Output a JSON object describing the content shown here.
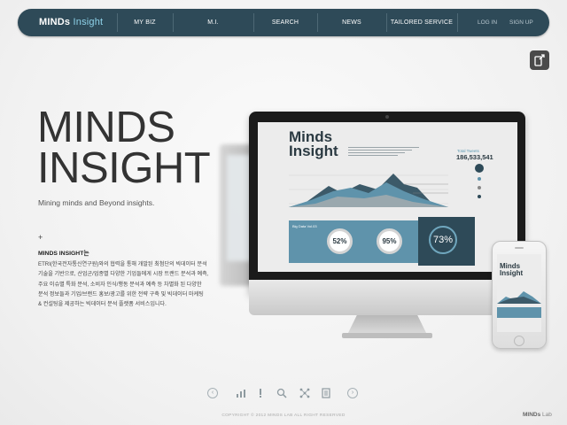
{
  "brand": {
    "name_bold": "MINDs",
    "name_light": " Insight"
  },
  "nav": {
    "items": [
      "MY BIZ",
      "M.I.",
      "SEARCH",
      "NEWS",
      "TAILORED SERVICE"
    ],
    "login": "LOG IN",
    "signup": "SIGN UP"
  },
  "hero": {
    "title_line1": "MINDS",
    "title_line2": "INSIGHT",
    "subtitle": "Mining minds and Beyond insights.",
    "plus": "+",
    "desc_title": "MINDS INSIGHT는",
    "desc_body": "ETRI(한국전자통신연구원)와의 협력을 통해 개발된 최첨단의 빅데이터 분석\n기술을 기반으로, 산업군/업종별 다양한 기업들에게 시장 트랜드 분석과 예측,\n주요 이슈별 특화 분석, 소비자 인식/행동 분석과 예측 등 차별화 된 다양한\n분석 정보들과 기업/브랜드 홍보/광고를 위한 전략 구축 및 빅데이터 마케팅\n& 컨설팅을 제공하는 빅데이터 분석 플랫폼 서비스입니다."
  },
  "device": {
    "screen_title": "Minds Insight",
    "phone_title": "Minds Insight",
    "stat_label": "Total Tweets",
    "stat_value": "186,533,541",
    "ring1": "52%",
    "ring2": "95%",
    "ring3": "73%",
    "panel_label": "Big Data Vol.03"
  },
  "bottom_nav": {
    "prev": "‹",
    "next": "›",
    "icons": [
      "chart-icon",
      "alert-icon",
      "search-icon",
      "network-icon",
      "document-icon"
    ]
  },
  "footer": {
    "copyright": "COPYRIGHT © 2012 MINDS LAB ALL RIGHT RESERVED",
    "logo_bold": "MINDs",
    "logo_light": " Lab"
  },
  "colors": {
    "nav_bg": "#2e4a58",
    "accent": "#5f93ab",
    "accent_light": "#8fd3ea"
  }
}
